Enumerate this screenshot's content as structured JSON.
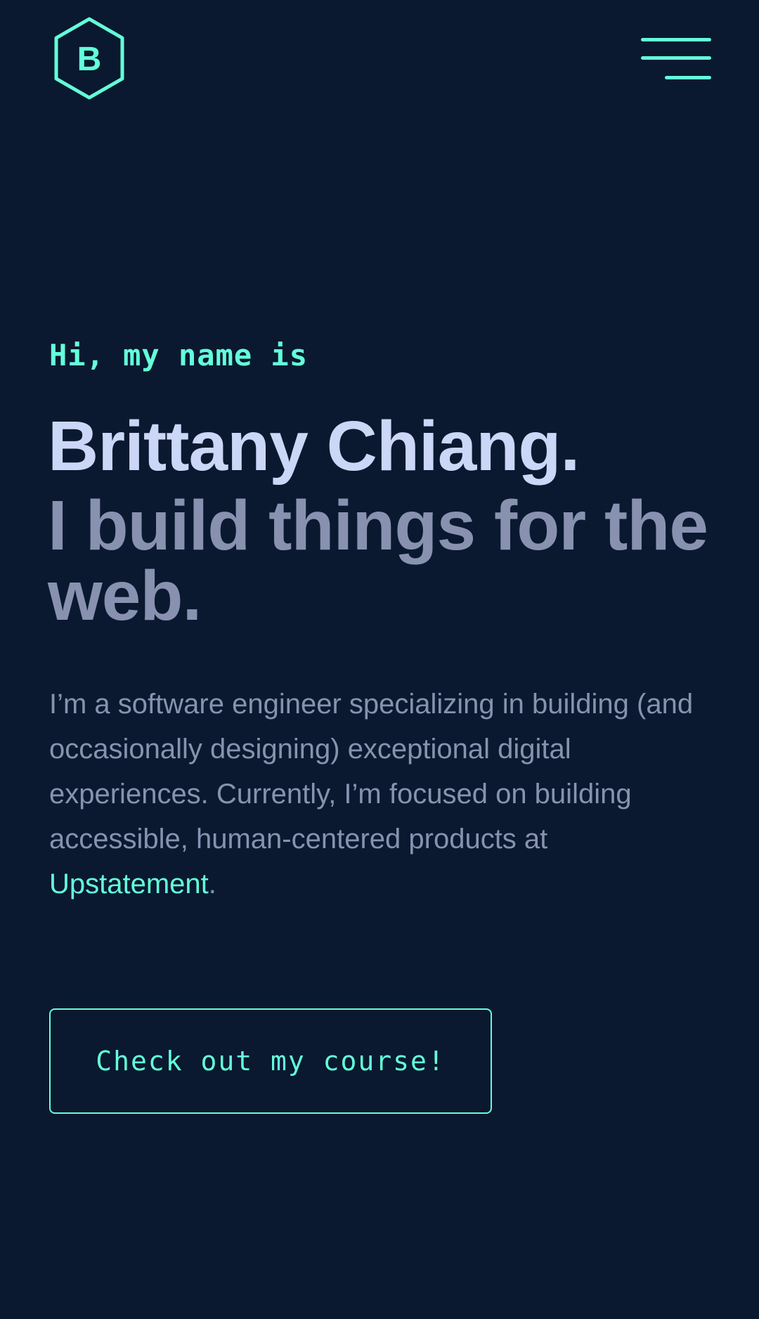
{
  "colors": {
    "background": "#0a192f",
    "accent": "#64ffda",
    "heading": "#ccd6f6",
    "muted": "#8892b0"
  },
  "header": {
    "logo_letter": "B",
    "logo_icon": "hexagon-logo-icon",
    "menu_icon": "hamburger-menu-icon"
  },
  "hero": {
    "greeting": "Hi, my name is",
    "name": "Brittany Chiang.",
    "tagline": "I build things for the web.",
    "intro_text": "I’m a software engineer specializing in building (and occasionally designing) exceptional digital experiences. Currently, I’m focused on building accessible, human-centered products at ",
    "intro_link": "Upstatement",
    "intro_end": ".",
    "cta_label": "Check out my course!"
  }
}
